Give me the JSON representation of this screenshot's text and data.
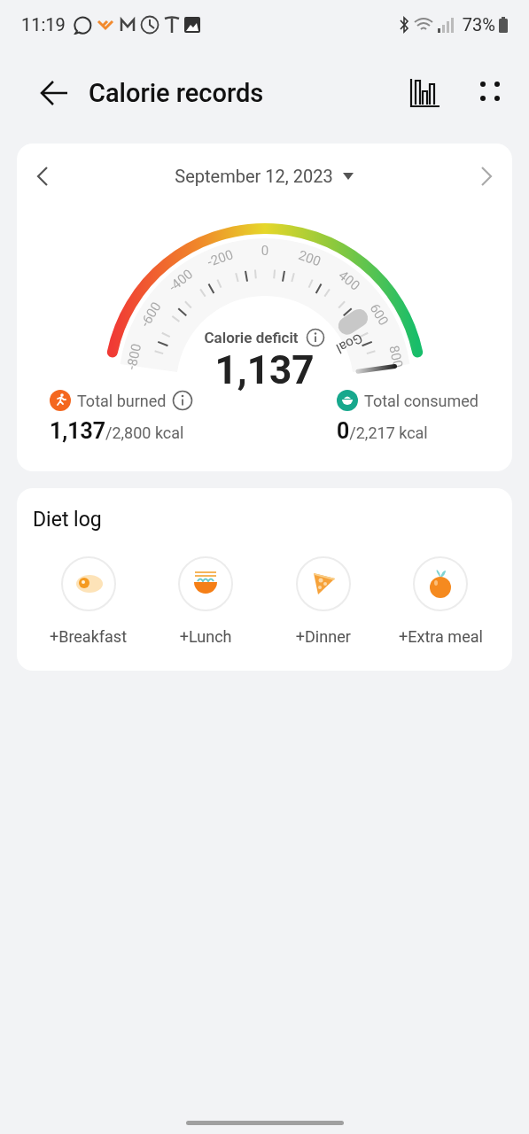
{
  "status_bar": {
    "time": "11:19",
    "battery": "73%"
  },
  "header": {
    "title": "Calorie records"
  },
  "summary": {
    "date": "September 12, 2023",
    "gauge": {
      "scale": [
        "-800",
        "-600",
        "-400",
        "-200",
        "0",
        "200",
        "400",
        "600",
        "800"
      ],
      "goal_label": "Goal",
      "label": "Calorie deficit",
      "value": "1,137"
    },
    "totals": [
      {
        "kind": "burned",
        "label": "Total burned",
        "info": true,
        "value": "1,137",
        "goal": "/2,800 kcal"
      },
      {
        "kind": "consumed",
        "label": "Total consumed",
        "info": false,
        "value": "0",
        "goal": "/2,217 kcal"
      }
    ]
  },
  "diet_log": {
    "title": "Diet log",
    "meals": [
      {
        "kind": "breakfast",
        "label": "+Breakfast"
      },
      {
        "kind": "lunch",
        "label": "+Lunch"
      },
      {
        "kind": "dinner",
        "label": "+Dinner"
      },
      {
        "kind": "extra",
        "label": "+Extra meal"
      }
    ]
  }
}
